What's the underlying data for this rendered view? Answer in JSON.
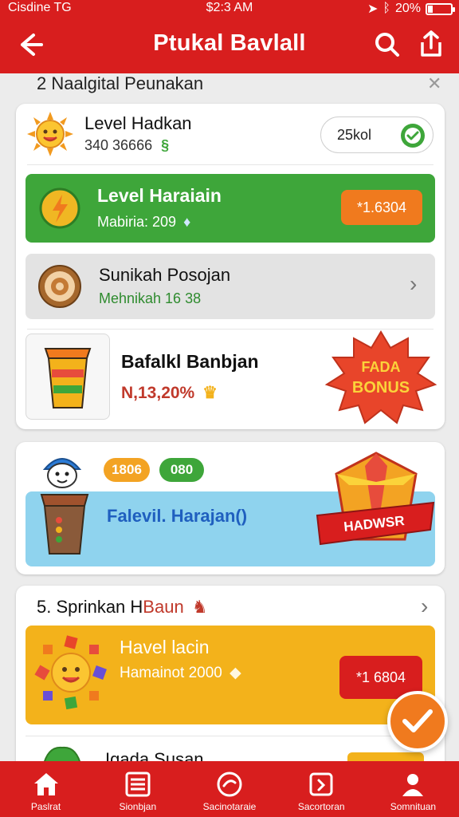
{
  "status": {
    "carrier": "Cisdine  TG",
    "time": "$2:3 AM",
    "battery": "20%",
    "battery_fraction": 0.2
  },
  "appbar": {
    "title": "Ptukal Bavlall"
  },
  "section1": {
    "header": "2  Naalgital Peunakan",
    "level_row": {
      "title": "Level Hadkan",
      "sub": "340 36666",
      "badge": "25kol"
    },
    "green_row": {
      "title": "Level Haraiain",
      "sub": "Mabiria: 209",
      "cta": "*1.6304"
    },
    "gray_row": {
      "title": "Sunikah Posojan",
      "sub": "Mehnikah 16  38"
    },
    "bonus_row": {
      "title": "Bafalkl Banbjan",
      "sub": "N,13,20%",
      "burst_top": "FADA",
      "burst_bottom": "BONUS"
    }
  },
  "section2": {
    "pill_orange": "1806",
    "pill_green": "080",
    "banner_title": "Falevil. Harajan()",
    "ribbon": "HADWSR"
  },
  "section3": {
    "header": "5. Sprinkan H",
    "header_accent": "Baun",
    "yellow_row": {
      "title": "Havel lacin",
      "sub": "Hamainot 2000",
      "cta": "*1 6804"
    },
    "last_row": {
      "title": "Igada Susan"
    }
  },
  "nav": [
    {
      "label": "Paslrat"
    },
    {
      "label": "Sionbjan"
    },
    {
      "label": "Sacinotaraie"
    },
    {
      "label": "Sacortoran"
    },
    {
      "label": "Somnituan"
    }
  ],
  "colors": {
    "brand_red": "#d81e1e",
    "green": "#3ea63a",
    "orange": "#f07a1e",
    "yellow": "#f3b21b",
    "blue": "#8fd3ee"
  }
}
